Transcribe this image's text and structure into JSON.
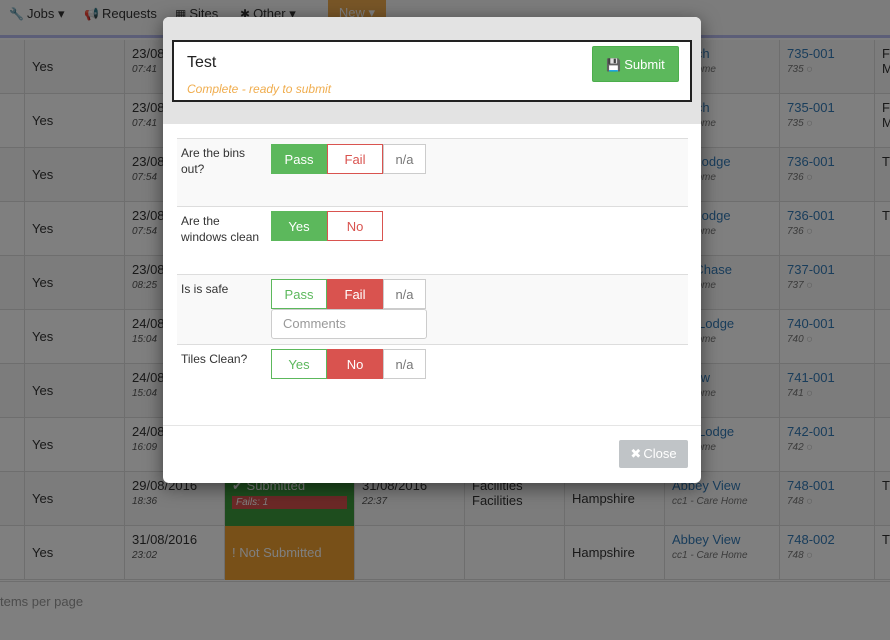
{
  "nav": {
    "jobs": "Jobs",
    "requests": "Requests",
    "sites": "Sites",
    "other": "Other",
    "new": "New"
  },
  "table_rows": [
    {
      "yes": "Yes",
      "date": "23/08",
      "time": "07:41",
      "site": "Reach",
      "site_sub": "are Home",
      "ref": "735-001",
      "ref_sub": "735",
      "last": "F",
      "last2": "M"
    },
    {
      "yes": "Yes",
      "date": "23/08",
      "time": "07:41",
      "site": "Reach",
      "site_sub": "are Home",
      "ref": "735-001",
      "ref_sub": "735",
      "last": "F",
      "last2": "M"
    },
    {
      "yes": "Yes",
      "date": "23/08",
      "time": "07:54",
      "site": "ore Lodge",
      "site_sub": "are Home",
      "ref": "736-001",
      "ref_sub": "736",
      "last": "T",
      "last2": ""
    },
    {
      "yes": "Yes",
      "date": "23/08",
      "time": "07:54",
      "site": "ore Lodge",
      "site_sub": "are Home",
      "ref": "736-001",
      "ref_sub": "736",
      "last": "T",
      "last2": ""
    },
    {
      "yes": "Yes",
      "date": "23/08",
      "time": "08:25",
      "site": "ord Chase",
      "site_sub": "are Home",
      "ref": "737-001",
      "ref_sub": "737",
      "last": "",
      "last2": ""
    },
    {
      "yes": "Yes",
      "date": "24/08",
      "time": "15:04",
      "site": "mar Lodge",
      "site_sub": "are Home",
      "ref": "740-001",
      "ref_sub": "740",
      "last": "",
      "last2": ""
    },
    {
      "yes": "Yes",
      "date": "24/08",
      "time": "15:04",
      "site": "y View",
      "site_sub": "are Home",
      "ref": "741-001",
      "ref_sub": "741",
      "last": "",
      "last2": ""
    },
    {
      "yes": "Yes",
      "date": "24/08",
      "time": "16:09",
      "site": "mar Lodge",
      "site_sub": "are Home",
      "ref": "742-001",
      "ref_sub": "742",
      "last": "",
      "last2": ""
    },
    {
      "yes": "Yes",
      "date": "29/08/2016",
      "time": "18:36",
      "status": "Submitted",
      "fails": "Fails: 1",
      "date2": "31/08/2016",
      "time2": "22:37",
      "dept": "Facilities",
      "dept2": "Facilities",
      "region": "Hampshire",
      "site": "Abbey View",
      "site_sub": "cc1 - Care Home",
      "ref": "748-001",
      "ref_sub": "748",
      "last": "T",
      "last2": ""
    },
    {
      "yes": "Yes",
      "date": "31/08/2016",
      "time": "23:02",
      "status": "Not Submitted",
      "region": "Hampshire",
      "site": "Abbey View",
      "site_sub": "cc1 - Care Home",
      "ref": "748-002",
      "ref_sub": "748",
      "last": "T",
      "last2": ""
    }
  ],
  "footer": {
    "items_per_page": "tems per page"
  },
  "modal": {
    "title": "Test",
    "status": "Complete - ready to submit",
    "submit_label": "Submit",
    "close_label": "Close",
    "questions": [
      {
        "label": "Are the bins out?",
        "options": [
          "Pass",
          "Fail",
          "n/a"
        ],
        "selected": "Pass"
      },
      {
        "label": "Are the windows clean",
        "options": [
          "Yes",
          "No"
        ],
        "selected": "Yes"
      },
      {
        "label": "Is is safe",
        "options": [
          "Pass",
          "Fail",
          "n/a"
        ],
        "selected": "Fail",
        "comments_placeholder": "Comments"
      },
      {
        "label": "Tiles Clean?",
        "options": [
          "Yes",
          "No",
          "n/a"
        ],
        "selected": "No"
      }
    ]
  },
  "colors": {
    "pass": "#5cb85c",
    "fail": "#d9534f",
    "warning": "#f0ad4e",
    "backdrop": "rgba(0,0,0,0.5)"
  }
}
